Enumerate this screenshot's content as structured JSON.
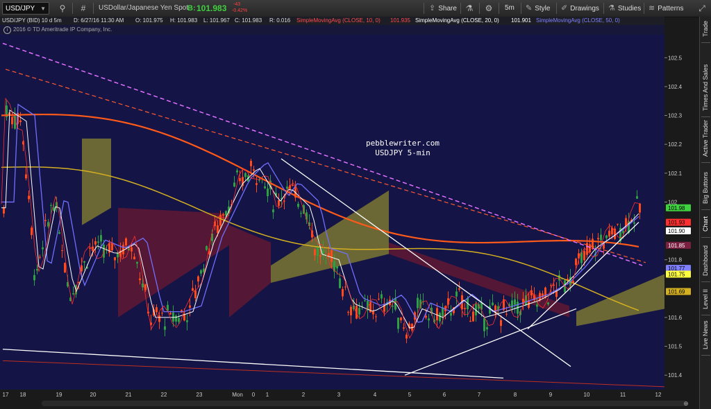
{
  "toolbar": {
    "symbol": "USD/JPY",
    "description": "USDollar/Japanese Yen Spot",
    "bid_label": "B:",
    "bid": "101.983",
    "change_top": "-43",
    "change_bottom": "-0.42%",
    "buttons": [
      "Share",
      "5m",
      "Style",
      "Drawings",
      "Studies",
      "Patterns"
    ]
  },
  "infobar": {
    "title": "USD/JPY (BID) 10 d 5m",
    "date": "D: 6/27/16 11:30 AM",
    "open": "O: 101.975",
    "high": "H: 101.983",
    "low": "L: 101.967",
    "close": "C: 101.983",
    "range": "R: 0.016",
    "studies": [
      {
        "label": "SimpleMovingAvg (CLOSE, 10, 0)",
        "value": "101.935",
        "color": "#ff4d4d"
      },
      {
        "label": "SimpleMovingAvg (CLOSE, 20, 0)",
        "value": "101.901",
        "color": "#ffffff"
      },
      {
        "label": "SimpleMovingAvg (CLOSE, 50, 0)",
        "value": "",
        "color": "#8080ff"
      }
    ]
  },
  "copyright": "2016 © TD Ameritrade IP Company, Inc.",
  "annotation": {
    "line1": "pebblewriter.com",
    "line2": "USDJPY 5-min"
  },
  "sidebar_tabs": [
    "Trade",
    "Times And Sales",
    "Active Trader",
    "Big Buttons",
    "Chart",
    "Dashboard",
    "Level II",
    "Live News"
  ],
  "colors": {
    "background": "#141446",
    "up": "#2ea043",
    "down": "#ff4a1a",
    "cloud_bull": "#8a8430",
    "cloud_bear": "#6a1830",
    "sma10": "#ff3030",
    "sma20": "#ffffff",
    "sma50": "#7070ff",
    "sma200": "#d4b020",
    "slowma": "#ff5a1a"
  },
  "chart_data": {
    "type": "candlestick",
    "title": "USD/JPY (BID) 10 d 5m",
    "ylim": [
      101.35,
      102.58
    ],
    "y_ticks": [
      "102.5",
      "102.4",
      "102.3",
      "102.2",
      "102.1",
      "102",
      "101.8",
      "101.6",
      "101.5",
      "101.4"
    ],
    "x_ticks": [
      "17",
      "18",
      "19",
      "20",
      "21",
      "22",
      "23",
      "Mon",
      "0",
      "1",
      "2",
      "3",
      "4",
      "5",
      "6",
      "7",
      "8",
      "9",
      "10",
      "11",
      "12"
    ],
    "price_flags": [
      {
        "value": "101.98",
        "color": "#3fd03f",
        "text_color": "#000000"
      },
      {
        "value": "101.93",
        "color": "#ff3030",
        "text_color": "#000000"
      },
      {
        "value": "101.90",
        "color": "#ffffff",
        "text_color": "#000000"
      },
      {
        "value": "101.85",
        "color": "#7a2040",
        "text_color": "#ffffff"
      },
      {
        "value": "101.77",
        "color": "#8080ff",
        "text_color": "#000000"
      },
      {
        "value": "101.75",
        "color": "#ffff40",
        "text_color": "#000000"
      },
      {
        "value": "101.69",
        "color": "#d4b020",
        "text_color": "#000000"
      }
    ]
  }
}
